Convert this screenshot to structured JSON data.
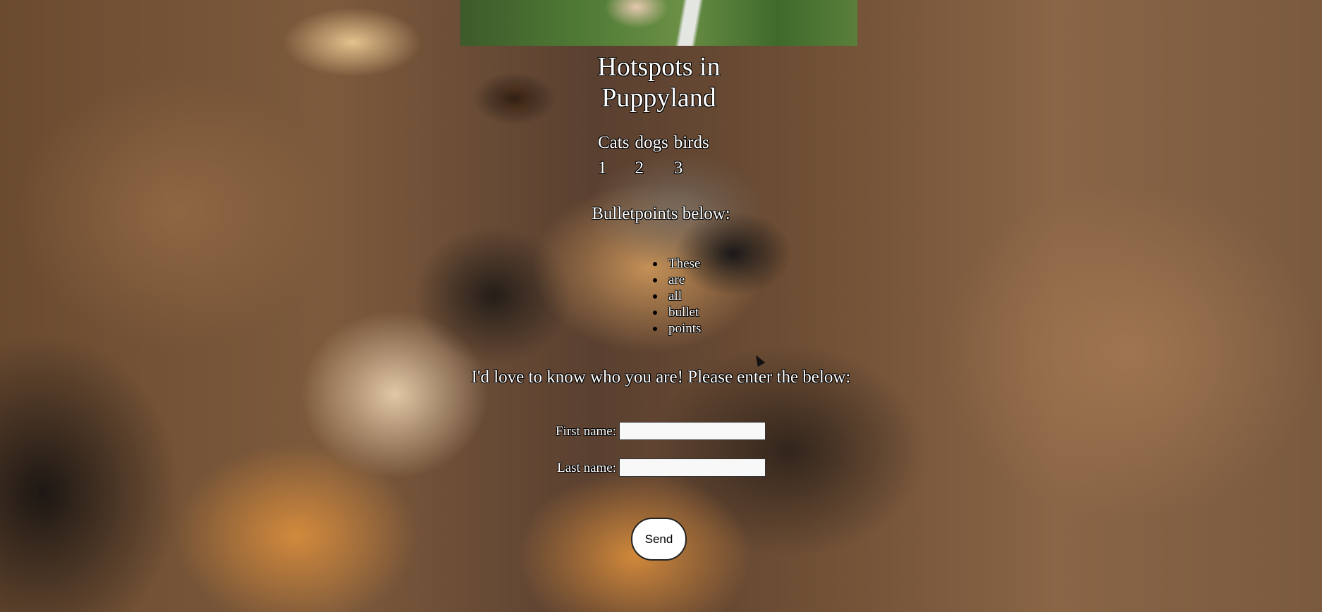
{
  "page": {
    "title": "Hotspots in Puppyland"
  },
  "stats_table": {
    "headers": [
      "Cats",
      "dogs",
      "birds"
    ],
    "values": [
      "1",
      "2",
      "3"
    ]
  },
  "bullets": {
    "heading": "Bulletpoints below:",
    "items": [
      "These",
      "are",
      "all",
      "bullet",
      "points"
    ]
  },
  "form": {
    "intro": "I'd love to know who you are! Please enter the below:",
    "first_name_label": "First name:",
    "first_name_value": "",
    "last_name_label": "Last name:",
    "last_name_value": "",
    "submit_label": "Send"
  }
}
